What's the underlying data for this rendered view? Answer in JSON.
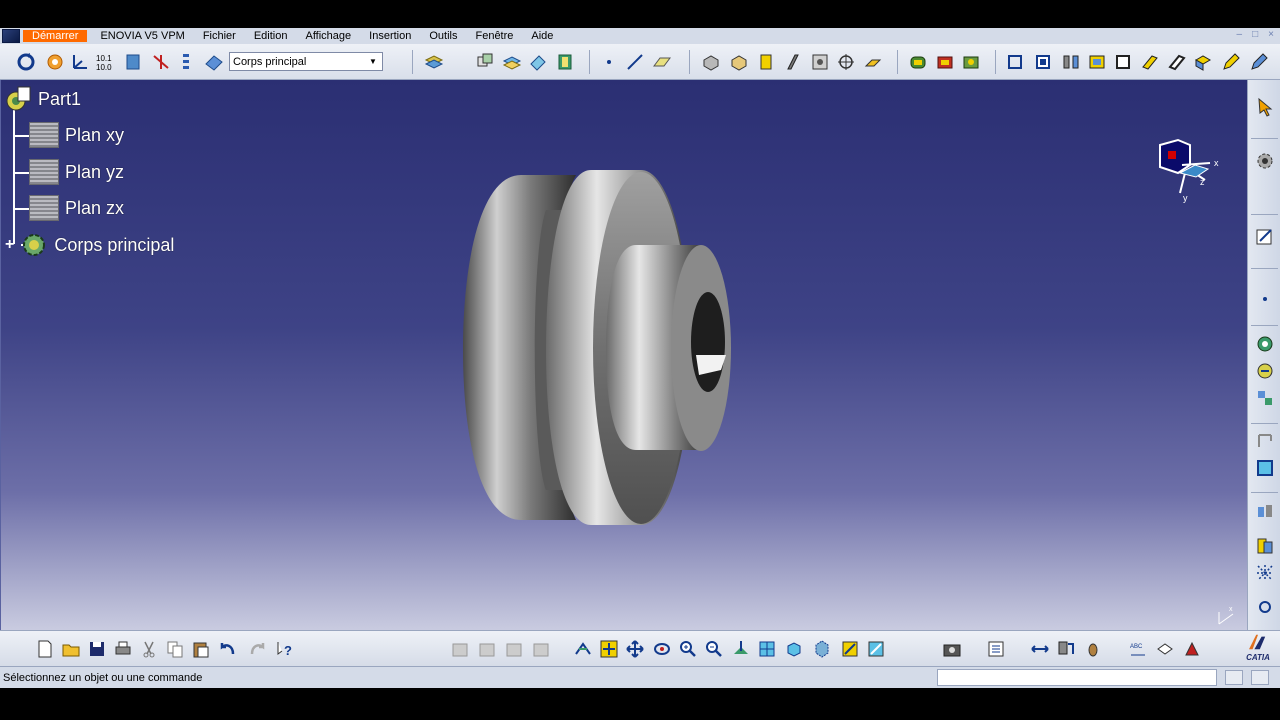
{
  "menu": {
    "items": [
      {
        "key": "start",
        "label": "Démarrer"
      },
      {
        "key": "enovia",
        "label": "ENOVIA V5 VPM"
      },
      {
        "key": "file",
        "label": "Fichier"
      },
      {
        "key": "edit",
        "label": "Edition"
      },
      {
        "key": "view",
        "label": "Affichage"
      },
      {
        "key": "insert",
        "label": "Insertion"
      },
      {
        "key": "tools",
        "label": "Outils"
      },
      {
        "key": "window",
        "label": "Fenêtre"
      },
      {
        "key": "help",
        "label": "Aide"
      }
    ]
  },
  "toolbar": {
    "body_combo_value": "Corps principal"
  },
  "tree": {
    "root": "Part1",
    "items": [
      {
        "label": "Plan xy",
        "icon": "plane-icon"
      },
      {
        "label": "Plan yz",
        "icon": "plane-icon"
      },
      {
        "label": "Plan zx",
        "icon": "plane-icon"
      },
      {
        "label": "Corps principal",
        "icon": "body-gear-icon"
      }
    ]
  },
  "compass": {
    "axis_x": "x",
    "axis_y": "y",
    "axis_z": "z"
  },
  "status": {
    "message": "Sélectionnez un objet ou une commande",
    "command_input": ""
  },
  "brand": {
    "logo_text": "CATIA"
  },
  "colors": {
    "viewport_top": "#2b2f73",
    "viewport_bottom": "#c9cbe0",
    "menu_active": "#ff6a00",
    "toolbar_bg": "#e3e8f1"
  }
}
